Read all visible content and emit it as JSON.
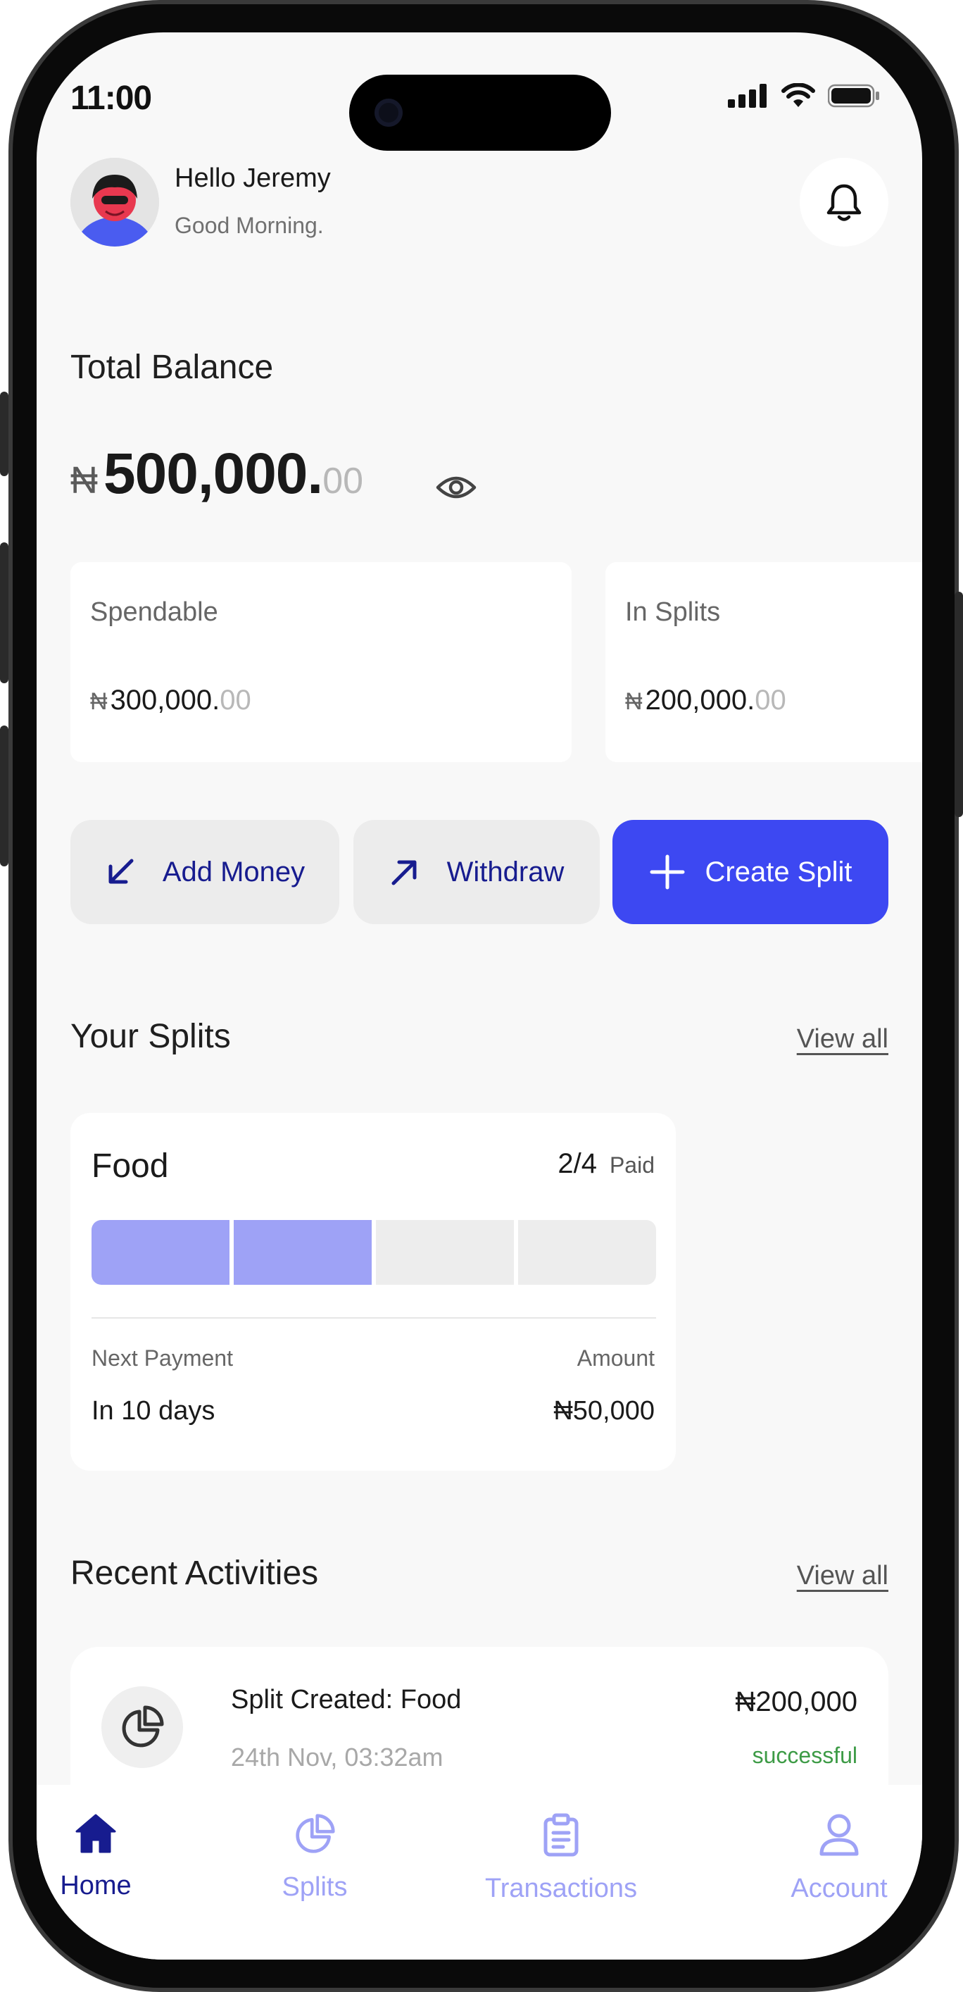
{
  "status_bar": {
    "time": "11:00"
  },
  "header": {
    "greeting": "Hello Jeremy",
    "subtitle": "Good Morning."
  },
  "balance": {
    "title": "Total Balance",
    "currency": "₦",
    "amount": "500,000.",
    "decimals": "00"
  },
  "cards": [
    {
      "label": "Spendable",
      "currency": "₦",
      "amount": "300,000.",
      "decimals": "00"
    },
    {
      "label": "In Splits",
      "currency": "₦",
      "amount": "200,000.",
      "decimals": "00"
    }
  ],
  "actions": {
    "add_money": "Add Money",
    "withdraw": "Withdraw",
    "create_split": "Create Split"
  },
  "splits_section": {
    "title": "Your Splits",
    "view_all": "View all"
  },
  "split": {
    "name": "Food",
    "paid_count": "2/4",
    "paid_label": "Paid",
    "paid": 2,
    "total": 4,
    "next_payment_label": "Next Payment",
    "next_payment_value": "In 10 days",
    "amount_label": "Amount",
    "amount_value": "₦50,000"
  },
  "activities_section": {
    "title": "Recent Activities",
    "view_all": "View all"
  },
  "activity": {
    "title": "Split Created: Food",
    "date": "24th Nov, 03:32am",
    "amount": "₦200,000",
    "status": "successful"
  },
  "tabs": [
    {
      "label": "Home",
      "icon": "home-icon",
      "active": true
    },
    {
      "label": "Splits",
      "icon": "pie-chart-icon",
      "active": false
    },
    {
      "label": "Transactions",
      "icon": "clipboard-icon",
      "active": false
    },
    {
      "label": "Account",
      "icon": "user-icon",
      "active": false
    }
  ],
  "colors": {
    "primary": "#3d48f2",
    "navy": "#171c8f",
    "paid_segment": "#9ea2f6",
    "success": "#3d9b46",
    "background": "#f8f8f8"
  }
}
